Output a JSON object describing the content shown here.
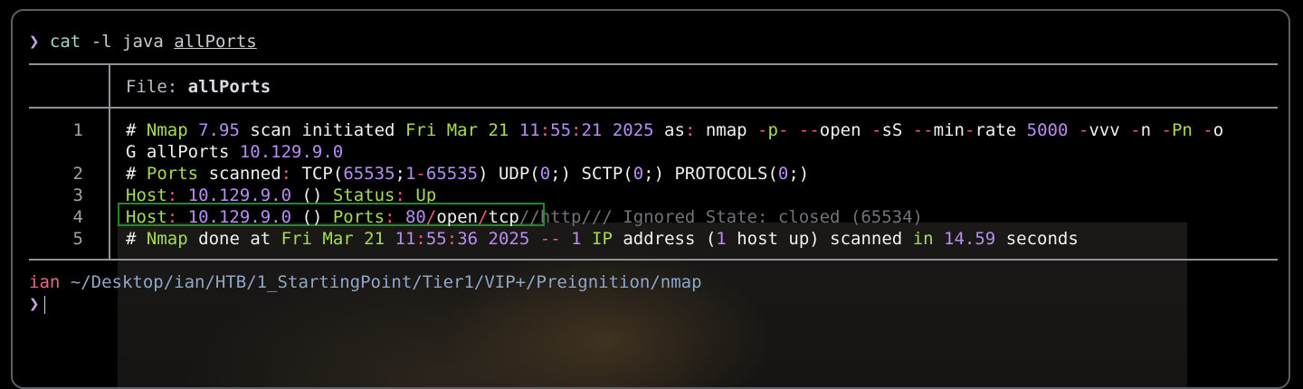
{
  "prompt": {
    "symbol": "❯",
    "command": "cat",
    "args": "-l java",
    "file_arg": "allPorts"
  },
  "viewer": {
    "header_label": "File:",
    "header_file": "allPorts",
    "line_numbers": [
      "1",
      "",
      "2",
      "3",
      "4",
      "5"
    ]
  },
  "lines": {
    "l1a": {
      "hash": "#",
      "nmap": "Nmap",
      "ver": "7.95",
      "scan_initiated": "scan initiated",
      "date": "Fri Mar 21",
      "h": "11",
      "c1": ":",
      "m": "55",
      "c2": ":",
      "s": "21",
      "year": "2025",
      "as": "as",
      "colon": ":",
      "cmd": "nmap",
      "dash1": "-",
      "p": "p",
      "dash2": "-",
      "dd1": "--",
      "open": "open",
      "dash3": "-",
      "sS": "sS",
      "dd2": "--",
      "min": "min",
      "dash4": "-",
      "rate": "rate",
      "num": "5000",
      "dash5": "-",
      "vvv": "vvv",
      "dash6": "-",
      "n": "n",
      "dash7": "-",
      "Pn": "Pn",
      "dash8": "-",
      "o": "o"
    },
    "l1b": {
      "g": "G allPorts",
      "ip": "10.129.9.0"
    },
    "l2": {
      "hash": "#",
      "ports": "Ports",
      "scanned": "scanned",
      "colon": ":",
      "tcp": "TCP(",
      "n65535": "65535",
      "semi1": ";",
      "n1": "1",
      "dash": "-",
      "n65535b": "65535",
      "udp": ") UDP(",
      "z1": "0",
      "semi2": ";",
      "sctp": ") SCTP(",
      "z2": "0",
      "semi3": ";",
      "proto": ") PROTOCOLS(",
      "z3": "0",
      "semi4": ";",
      "close": ")"
    },
    "l3": {
      "host": "Host",
      "colon1": ":",
      "ip": "10.129.9.0",
      "paren": "()",
      "status": "Status",
      "colon2": ":",
      "up": "Up"
    },
    "l4": {
      "host": "Host",
      "colon1": ":",
      "ip": "10.129.9.0",
      "paren": "()",
      "ports": "Ports",
      "colon2": ":",
      "port": "80",
      "s1": "/",
      "open": "open",
      "s2": "/",
      "tcp": "tcp",
      "rest": "//http/// Ignored State: closed (65534)"
    },
    "l5": {
      "hash": "#",
      "nmap": "Nmap",
      "done_at": "done at",
      "date": "Fri Mar 21",
      "h": "11",
      "c1": ":",
      "m": "55",
      "c2": ":",
      "s": "36",
      "year": "2025",
      "dd": "--",
      "one": "1",
      "ipword": "IP",
      "address": "address (",
      "one_b": "1",
      "hostup": "host up) scanned",
      "in": "in",
      "secs": "14.59",
      "seconds": "seconds"
    }
  },
  "shell": {
    "user": "ian",
    "cwd": "~/Desktop/ian/HTB/1_StartingPoint/Tier1/VIP+/Preignition/nmap",
    "symbol": "❯"
  }
}
